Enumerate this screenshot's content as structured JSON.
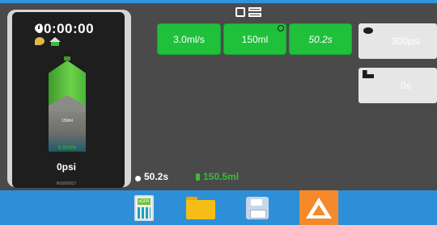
{
  "injector": {
    "timer": "00:00:00",
    "volume_label": "150ml",
    "flow_label": "0.0ml/s",
    "pressure": "0psi",
    "serial": "IN1600017"
  },
  "phases": [
    {
      "label": "3.0ml/s"
    },
    {
      "label": "150ml"
    },
    {
      "label": "50.2s"
    }
  ],
  "right_buttons": {
    "pressure": "300psi",
    "delay": "0s"
  },
  "bottom_status": {
    "time": "50.2s",
    "volume": "150.5ml"
  },
  "taskbar": {
    "egfr_label": "eGFR"
  },
  "colors": {
    "accent_blue": "#2d8fd8",
    "phase_green": "#1fc03a",
    "alert_orange": "#f48a2a"
  },
  "icons": [
    "clock-icon",
    "drop-icon",
    "home-icon",
    "bed-icon",
    "calculator-icon",
    "folder-icon",
    "save-icon",
    "alert-icon"
  ]
}
